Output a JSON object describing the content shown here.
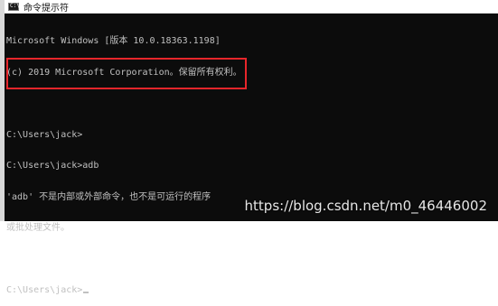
{
  "window": {
    "title": "命令提示符",
    "icon": "cmd-icon"
  },
  "console": {
    "lines": [
      "Microsoft Windows [版本 10.0.18363.1198]",
      "(c) 2019 Microsoft Corporation。保留所有权利。",
      "",
      "C:\\Users\\jack>",
      "C:\\Users\\jack>adb",
      "'adb' 不是内部或外部命令，也不是可运行的程序",
      "或批处理文件。",
      "",
      "C:\\Users\\jack>"
    ]
  },
  "watermark": "https://blog.csdn.net/m0_46446002",
  "colors": {
    "console_bg": "#0c0c0c",
    "console_text": "#c0c0c0",
    "highlight_border": "#e8262b"
  }
}
